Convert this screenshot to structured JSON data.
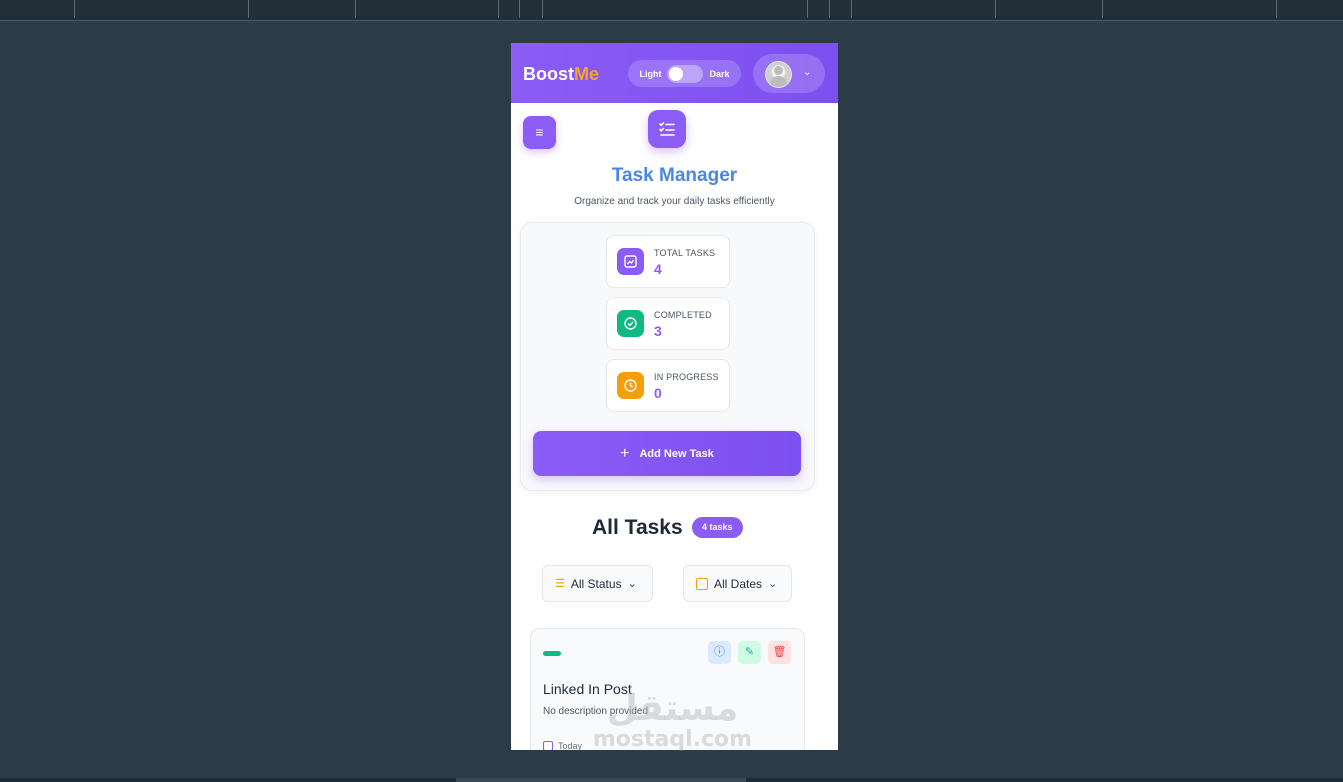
{
  "header": {
    "brand_primary": "Boost",
    "brand_accent": "Me",
    "theme_light": "Light",
    "theme_dark": "Dark"
  },
  "page": {
    "title": "Task Manager",
    "subtitle": "Organize and track your daily tasks efficiently"
  },
  "stats": [
    {
      "label": "TOTAL TASKS",
      "value": "4",
      "icon": "chart-icon",
      "color": "#8b5cf6"
    },
    {
      "label": "COMPLETED",
      "value": "3",
      "icon": "check-circle-icon",
      "color": "#10b981"
    },
    {
      "label": "IN PROGRESS",
      "value": "0",
      "icon": "clock-icon",
      "color": "#f59e0b"
    }
  ],
  "add_task_label": "Add New Task",
  "list": {
    "heading": "All Tasks",
    "count": "4 tasks",
    "status_filter": "All Status",
    "date_filter": "All Dates"
  },
  "tasks": [
    {
      "title": "Linked In Post",
      "description": "No description provided",
      "date": "Today",
      "status_color": "#10b981"
    }
  ],
  "watermark": {
    "arabic": "مستقل",
    "latin": "mostaql.com"
  },
  "colors": {
    "accent": "#8b5cf6",
    "brand_accent": "#f5a524",
    "title_blue": "#4a86e8"
  }
}
